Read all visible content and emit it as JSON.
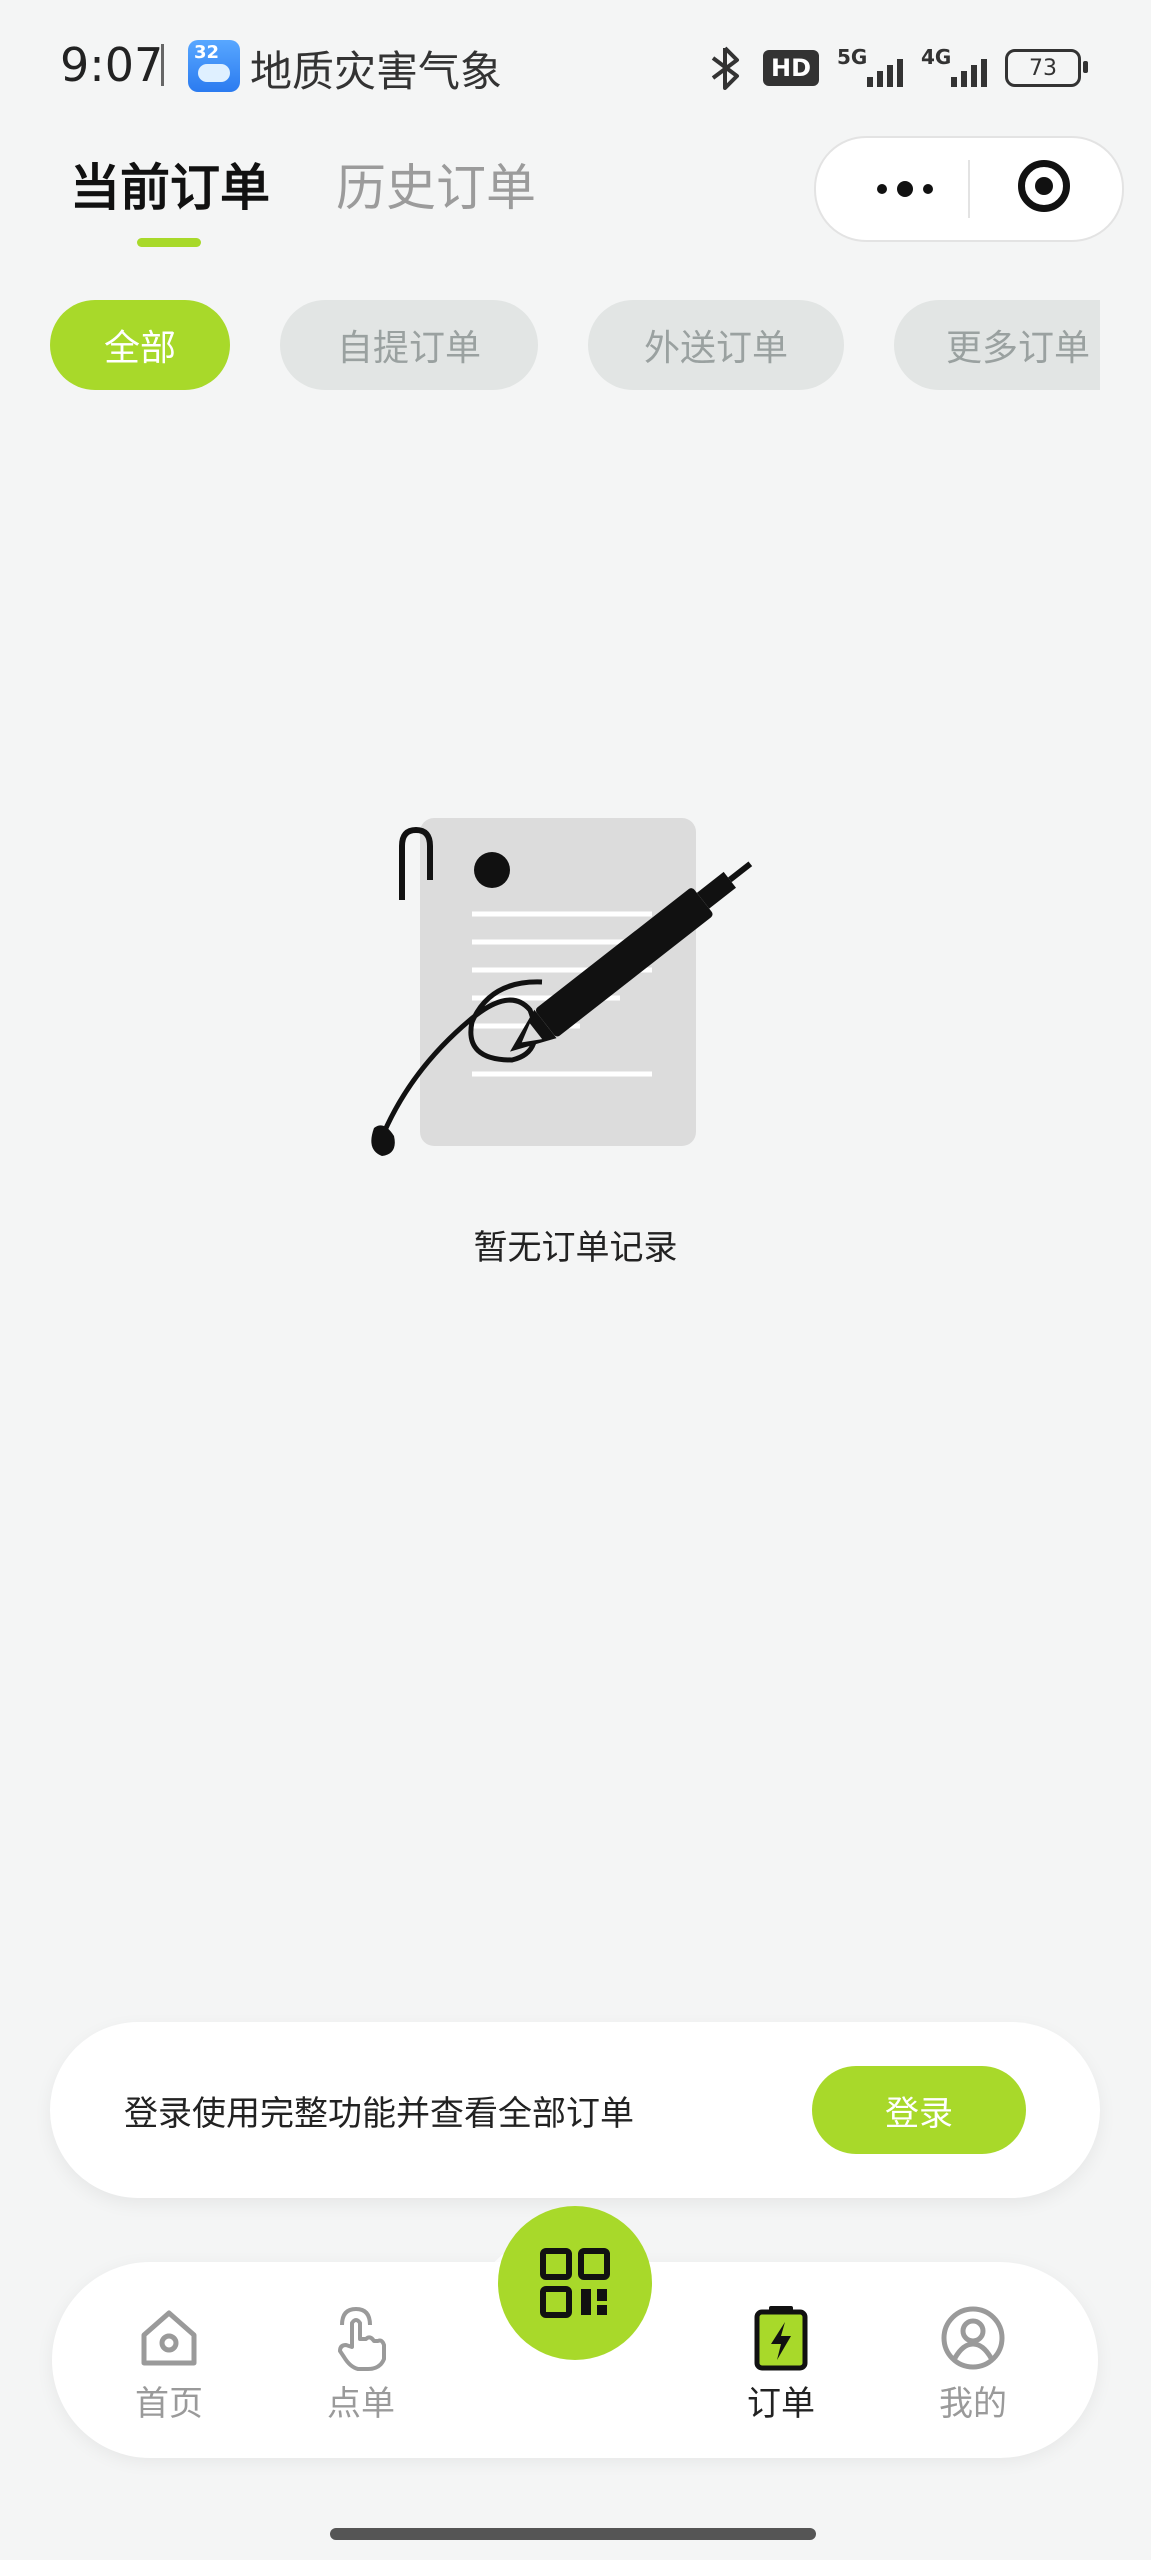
{
  "status_bar": {
    "time": "9:07",
    "weather_badge": "32",
    "app_name": "地质灾害气象",
    "hd_label": "HD",
    "network_1": "5G",
    "network_2": "4G",
    "battery": "73"
  },
  "header": {
    "tabs": [
      {
        "label": "当前订单",
        "active": true
      },
      {
        "label": "历史订单",
        "active": false
      }
    ]
  },
  "filters": [
    {
      "label": "全部",
      "active": true
    },
    {
      "label": "自提订单",
      "active": false
    },
    {
      "label": "外送订单",
      "active": false
    },
    {
      "label": "更多订单",
      "active": false
    }
  ],
  "empty_state": {
    "text": "暂无订单记录"
  },
  "login_banner": {
    "text": "登录使用完整功能并查看全部订单",
    "button": "登录"
  },
  "bottom_nav": {
    "items": [
      {
        "label": "首页",
        "icon": "home-icon",
        "active": false
      },
      {
        "label": "点单",
        "icon": "tap-hand-icon",
        "active": false
      },
      {
        "label": "订单",
        "icon": "order-clipboard-icon",
        "active": true
      },
      {
        "label": "我的",
        "icon": "profile-icon",
        "active": false
      }
    ],
    "center_icon": "qr-code-icon"
  },
  "colors": {
    "accent": "#a8d92a",
    "background": "#f4f5f5",
    "chip_inactive": "#e2e5e4"
  }
}
